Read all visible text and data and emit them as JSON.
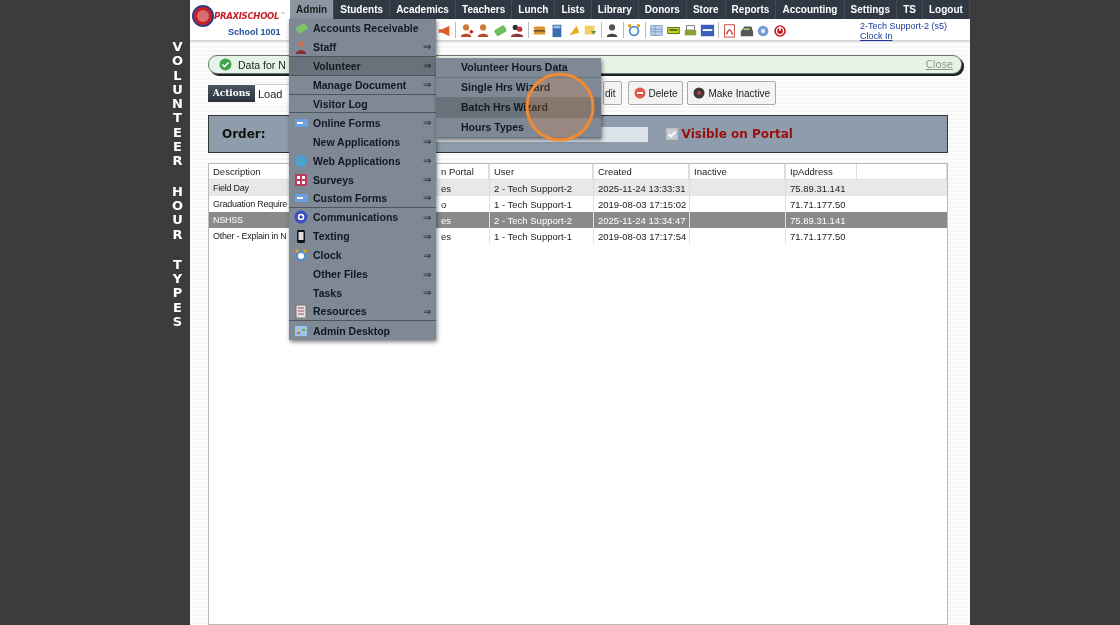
{
  "side_title": "VOLUNTEER HOUR TYPES",
  "logo": {
    "brand": "PRAXISCHOOL",
    "tm": "™",
    "school": "School 1001"
  },
  "nav": [
    {
      "label": "Admin",
      "selected": true
    },
    {
      "label": "Students",
      "selected": false
    },
    {
      "label": "Academics",
      "selected": false
    },
    {
      "label": "Teachers",
      "selected": false
    },
    {
      "label": "Lunch",
      "selected": false
    },
    {
      "label": "Lists",
      "selected": false
    },
    {
      "label": "Library",
      "selected": false
    },
    {
      "label": "Donors",
      "selected": false
    },
    {
      "label": "Store",
      "selected": false
    },
    {
      "label": "Reports",
      "selected": false
    },
    {
      "label": "Accounting",
      "selected": false
    },
    {
      "label": "Settings",
      "selected": false
    },
    {
      "label": "TS",
      "selected": false
    },
    {
      "label": "Logout",
      "selected": false
    }
  ],
  "user": {
    "name": "2-Tech Support-2 (s5)",
    "link": "Clock In"
  },
  "notice": {
    "text": "Data for N",
    "close": "Close"
  },
  "actions": {
    "menu": "Actions",
    "field": "Load",
    "buttons": [
      "dit",
      "Delete",
      "Make Inactive"
    ]
  },
  "order": {
    "label": "Order:",
    "visible_on_portal": {
      "label": "Visible on Portal",
      "checked": true
    }
  },
  "table": {
    "columns": [
      "Description",
      "n Portal",
      "User",
      "Created",
      "Inactive",
      "IpAddress"
    ],
    "rows": [
      {
        "selected": false,
        "cells": [
          "Field Day",
          "es",
          "2 - Tech Support-2",
          "2025-11-24 13:33:31",
          "",
          "75.89.31.141"
        ]
      },
      {
        "selected": false,
        "cells": [
          "Graduation Require",
          "o",
          "1 - Tech Support-1",
          "2019-08-03 17:15:02",
          "",
          "71.71.177.50"
        ]
      },
      {
        "selected": true,
        "cells": [
          "NSHSS",
          "es",
          "2 - Tech Support-2",
          "2025-11-24 13:34:47",
          "",
          "75.89.31.141"
        ]
      },
      {
        "selected": false,
        "cells": [
          "Other - Explain in N",
          "es",
          "1 - Tech Support-1",
          "2019-08-03 17:17:54",
          "",
          "71.71.177.50"
        ]
      }
    ]
  },
  "admin_menu": [
    {
      "label": "Accounts Receivable",
      "selected": false
    },
    {
      "label": "Staff",
      "arrow": "⇒",
      "selected": false
    },
    {
      "label": "Volunteer",
      "arrow": "⇒",
      "selected": true
    },
    {
      "label": "Manage Document",
      "arrow": "⇒",
      "selected": false
    },
    {
      "label": "Visitor Log",
      "selected": false
    },
    {
      "label": "Online Forms",
      "arrow": "⇒",
      "selected": false
    },
    {
      "label": "New Applications",
      "arrow": "⇒",
      "selected": false
    },
    {
      "label": "Web Applications",
      "arrow": "⇒",
      "selected": false
    },
    {
      "label": "Surveys",
      "arrow": "⇒",
      "selected": false
    },
    {
      "label": "Custom Forms",
      "arrow": "⇒",
      "selected": false
    },
    {
      "label": "Communications",
      "arrow": "⇒",
      "selected": false
    },
    {
      "label": "Texting",
      "arrow": "⇒",
      "selected": false
    },
    {
      "label": "Clock",
      "arrow": "⇒",
      "selected": false
    },
    {
      "label": "Other Files",
      "arrow": "⇒",
      "selected": false
    },
    {
      "label": "Tasks",
      "arrow": "⇒",
      "selected": false
    },
    {
      "label": "Resources",
      "arrow": "⇒",
      "selected": false
    },
    {
      "label": "Admin Desktop",
      "selected": false
    }
  ],
  "volunteer_menu": [
    {
      "label": "Volunteer Hours Data",
      "selected": false
    },
    {
      "label": "Single Hrs Wizard",
      "selected": false
    },
    {
      "label": "Batch Hrs Wizard",
      "selected": true
    },
    {
      "label": "Hours Types",
      "selected": false
    }
  ]
}
